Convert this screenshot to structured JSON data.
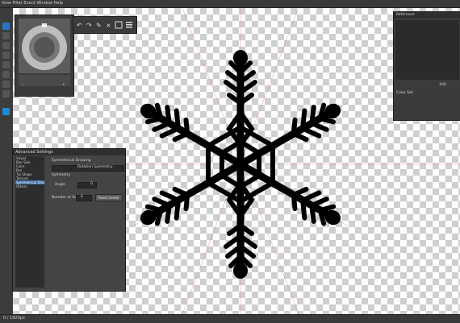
{
  "menu": {
    "label": "View Filter Event Window Help"
  },
  "status": {
    "text": "0 / 1920px"
  },
  "right_panel": {
    "tab_label": "Reference",
    "zoom_text": "100",
    "section2_label": "Color Set"
  },
  "advanced_settings": {
    "title": "Advanced Settings",
    "list": [
      "Visual",
      "Blur Size",
      "Color",
      "Pen",
      "Tip Shape",
      "Texture",
      "Symmetrical Drawing",
      "Others"
    ],
    "selected_index": 6,
    "option1_label": "Symmetrical Drawing",
    "option1_field": "Rotation Symmetry",
    "option2_label": "Symmetry",
    "angle_label": "Angle",
    "angle_value": "0",
    "sections_label": "Number of Sections",
    "sections_value": "6",
    "reset_label": "Reset Center"
  },
  "icons": [
    "undo-icon",
    "redo-icon",
    "pen-icon",
    "clear-icon",
    "transform-icon",
    "menu-icon",
    "home-icon",
    "zoom-in-icon",
    "zoom-out-icon"
  ]
}
